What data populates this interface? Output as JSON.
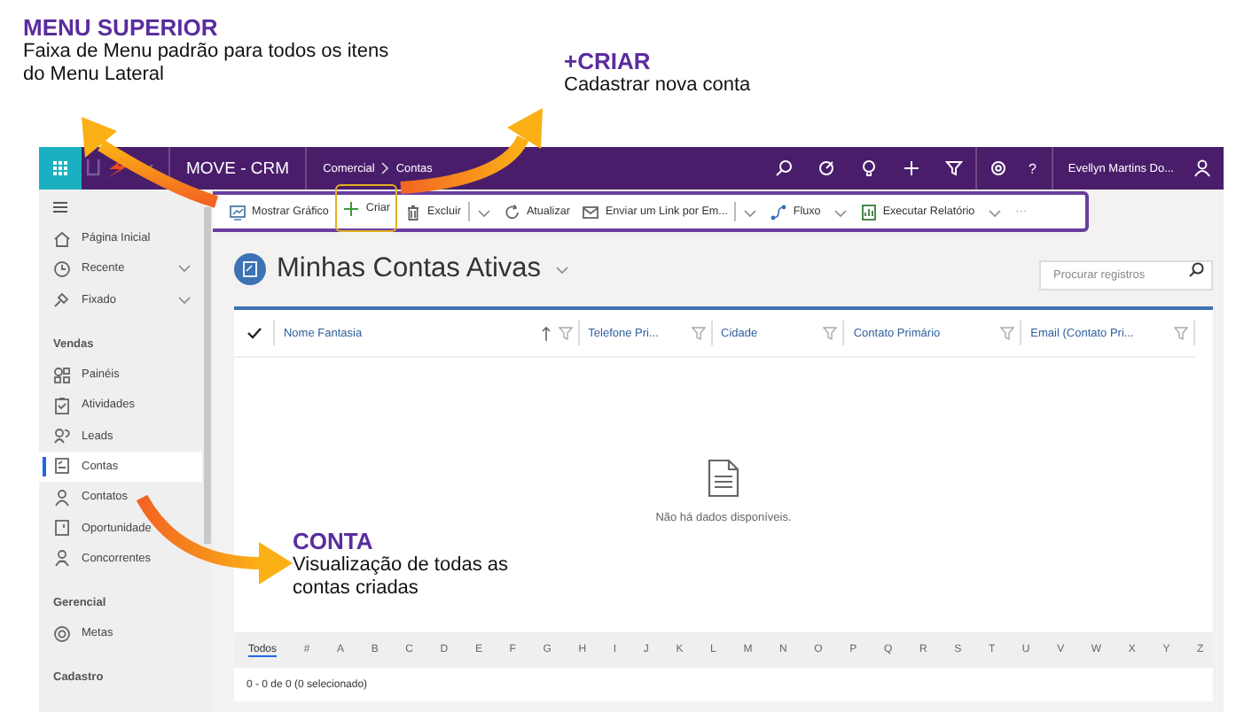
{
  "annotations": [
    {
      "kind": "menu",
      "title": "MENU SUPERIOR",
      "text": "Faixa de Menu padrão para todos os itens do Menu Lateral"
    },
    {
      "kind": "create",
      "title": "+CRIAR",
      "text": "Cadastrar nova conta"
    },
    {
      "kind": "list",
      "title": "CONTA",
      "text": "Visualização de todas as contas criadas"
    }
  ],
  "header": {
    "app_name": "MOVE - CRM",
    "breadcrumb": [
      "Comercial",
      "Contas"
    ],
    "help": "?",
    "user": "Evellyn Martins Do..."
  },
  "command_bar": {
    "items": [
      {
        "kind": "chart",
        "label": "Mostrar Gráfico",
        "highlighted": false,
        "dropdown": false
      },
      {
        "kind": "create",
        "label": "Criar",
        "highlighted": true,
        "dropdown": false
      },
      {
        "kind": "delete",
        "label": "Excluir",
        "highlighted": false,
        "dropdown": true
      },
      {
        "kind": "refresh",
        "label": "Atualizar",
        "highlighted": false,
        "dropdown": false
      },
      {
        "kind": "email",
        "label": "Enviar um Link por Em...",
        "highlighted": false,
        "dropdown": true
      },
      {
        "kind": "flow",
        "label": "Fluxo",
        "highlighted": false,
        "dropdown": true
      },
      {
        "kind": "report",
        "label": "Executar Relatório",
        "highlighted": false,
        "dropdown": true
      }
    ],
    "more": "···"
  },
  "sidebar": {
    "groups": [
      {
        "items": [
          {
            "kind": "home",
            "label": "Página Inicial",
            "selected": false
          },
          {
            "kind": "recent",
            "label": "Recente",
            "selected": false,
            "expanded": false
          },
          {
            "kind": "pin",
            "label": "Fixado",
            "selected": false,
            "expanded": false
          }
        ]
      },
      {
        "heading": "Vendas",
        "items": [
          {
            "kind": "dashboard",
            "label": "Painéis",
            "selected": false
          },
          {
            "kind": "activities",
            "label": "Atividades",
            "selected": false
          },
          {
            "kind": "leads",
            "label": "Leads",
            "selected": false
          },
          {
            "kind": "accounts",
            "label": "Contas",
            "selected": true
          },
          {
            "kind": "contacts",
            "label": "Contatos",
            "selected": false
          },
          {
            "kind": "opportunity",
            "label": "Oportunidade",
            "selected": false
          },
          {
            "kind": "competitors",
            "label": "Concorrentes",
            "selected": false
          }
        ]
      },
      {
        "heading": "Gerencial",
        "items": [
          {
            "kind": "goals",
            "label": "Metas",
            "selected": false
          }
        ]
      },
      {
        "heading": "Cadastro"
      }
    ]
  },
  "view": {
    "title": "Minhas Contas Ativas",
    "search": {
      "placeholder": "Procurar registros"
    }
  },
  "table": {
    "columns": [
      {
        "label": "Nome Fantasia",
        "sorted_ascending": true
      },
      {
        "label": "Telefone Pri...",
        "sorted_ascending": false
      },
      {
        "label": "Cidade",
        "sorted_ascending": false
      },
      {
        "label": "Contato Primário",
        "sorted_ascending": false
      },
      {
        "label": "Email (Contato Pri...",
        "sorted_ascending": false
      }
    ],
    "empty_message": "Não há dados disponíveis.",
    "alphabet": [
      {
        "label": "Todos",
        "selected": true
      },
      {
        "label": "#",
        "selected": false
      },
      {
        "label": "A",
        "selected": false
      },
      {
        "label": "B",
        "selected": false
      },
      {
        "label": "C",
        "selected": false
      },
      {
        "label": "D",
        "selected": false
      },
      {
        "label": "E",
        "selected": false
      },
      {
        "label": "F",
        "selected": false
      },
      {
        "label": "G",
        "selected": false
      },
      {
        "label": "H",
        "selected": false
      },
      {
        "label": "I",
        "selected": false
      },
      {
        "label": "J",
        "selected": false
      },
      {
        "label": "K",
        "selected": false
      },
      {
        "label": "L",
        "selected": false
      },
      {
        "label": "M",
        "selected": false
      },
      {
        "label": "N",
        "selected": false
      },
      {
        "label": "O",
        "selected": false
      },
      {
        "label": "P",
        "selected": false
      },
      {
        "label": "Q",
        "selected": false
      },
      {
        "label": "R",
        "selected": false
      },
      {
        "label": "S",
        "selected": false
      },
      {
        "label": "T",
        "selected": false
      },
      {
        "label": "U",
        "selected": false
      },
      {
        "label": "V",
        "selected": false
      },
      {
        "label": "W",
        "selected": false
      },
      {
        "label": "X",
        "selected": false
      },
      {
        "label": "Y",
        "selected": false
      },
      {
        "label": "Z",
        "selected": false
      }
    ],
    "footer": "0 - 0 de 0 (0 selecionado)"
  }
}
